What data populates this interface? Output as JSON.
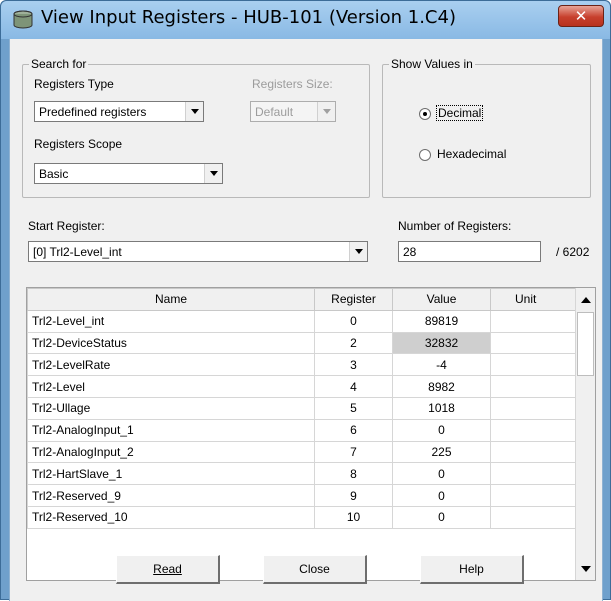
{
  "window": {
    "title": "View Input Registers - HUB-101 (Version 1.C4)",
    "close_label": "✕"
  },
  "search_group": {
    "legend": "Search for",
    "registers_type_label": "Registers Type",
    "registers_type_value": "Predefined registers",
    "registers_size_label": "Registers Size:",
    "registers_size_value": "Default",
    "registers_scope_label": "Registers Scope",
    "registers_scope_value": "Basic"
  },
  "show_values_group": {
    "legend": "Show Values in",
    "decimal_label": "Decimal",
    "hexadecimal_label": "Hexadecimal",
    "selected": "Decimal"
  },
  "start_register": {
    "label": "Start Register:",
    "value": "[0] Trl2-Level_int"
  },
  "number_of_registers": {
    "label": "Number of Registers:",
    "value": "28",
    "total": "/ 6202"
  },
  "table": {
    "headers": [
      "Name",
      "Register",
      "Value",
      "Unit"
    ],
    "rows": [
      {
        "name": "Trl2-Level_int",
        "register": "0",
        "value": "89819",
        "unit": ""
      },
      {
        "name": "Trl2-DeviceStatus",
        "register": "2",
        "value": "32832",
        "unit": ""
      },
      {
        "name": "Trl2-LevelRate",
        "register": "3",
        "value": "-4",
        "unit": ""
      },
      {
        "name": "Trl2-Level",
        "register": "4",
        "value": "8982",
        "unit": ""
      },
      {
        "name": "Trl2-Ullage",
        "register": "5",
        "value": "1018",
        "unit": ""
      },
      {
        "name": "Trl2-AnalogInput_1",
        "register": "6",
        "value": "0",
        "unit": ""
      },
      {
        "name": "Trl2-AnalogInput_2",
        "register": "7",
        "value": "225",
        "unit": ""
      },
      {
        "name": "Trl2-HartSlave_1",
        "register": "8",
        "value": "0",
        "unit": ""
      },
      {
        "name": "Trl2-Reserved_9",
        "register": "9",
        "value": "0",
        "unit": ""
      },
      {
        "name": "Trl2-Reserved_10",
        "register": "10",
        "value": "0",
        "unit": ""
      }
    ]
  },
  "buttons": {
    "read": "Read",
    "close": "Close",
    "help": "Help"
  },
  "colors": {
    "titlebar": "#89b9e4",
    "close_button": "#c7402d",
    "selected_cell": "#cfcfcf"
  }
}
